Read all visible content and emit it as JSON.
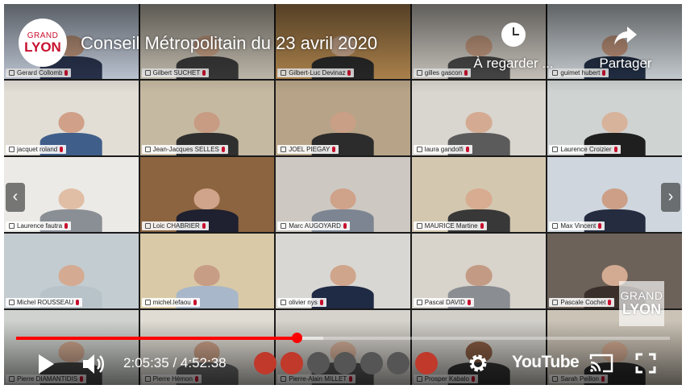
{
  "video": {
    "title": "Conseil Métropolitain du 23 avril 2020",
    "logo_line1": "GRAND",
    "logo_line2": "LYON",
    "watch_later_label": "À regarder ...",
    "share_label": "Partager",
    "watermark_line1": "GRAND",
    "watermark_line2": "LYON",
    "current_time": "2:05:35",
    "duration": "4:52:38",
    "time_display": "2:05:35 / 4:52:38",
    "progress_fraction": 0.4294,
    "buffered_fraction": 0.47,
    "youtube_label": "YouTube",
    "colors": {
      "accent": "#ff0000",
      "brand": "#c8102e"
    }
  },
  "participants": [
    {
      "name": "Gerard Collomb",
      "wall": "#c9d3e2",
      "skin": "#c49a80",
      "shirt": "#2b3550"
    },
    {
      "name": "Gilbert SUCHET",
      "wall": "#cdc6b8",
      "skin": "#d3a98c",
      "shirt": "#3b3b3b"
    },
    {
      "name": "Gilbert-Luc Devinaz",
      "wall": "#b98c52",
      "skin": "#d8b498",
      "shirt": "#2a2a2a"
    },
    {
      "name": "gilles gascon",
      "wall": "#d5d0c8",
      "skin": "#cfa488",
      "shirt": "#4a4a4a"
    },
    {
      "name": "guimet hubert",
      "wall": "#d4dbe0",
      "skin": "#c99b82",
      "shirt": "#233046"
    },
    {
      "name": "jacquet roland",
      "wall": "#e2ded6",
      "skin": "#d0a088",
      "shirt": "#3f5f8a"
    },
    {
      "name": "Jean-Jacques SELLES",
      "wall": "#c6b9a2",
      "skin": "#c89c83",
      "shirt": "#2f2f2f"
    },
    {
      "name": "JOEL PIEGAY",
      "wall": "#b7a488",
      "skin": "#c99f86",
      "shirt": "#2c2c2c"
    },
    {
      "name": "laura gandolfi",
      "wall": "#d9d5cf",
      "skin": "#d4ab92",
      "shirt": "#5b5b5b"
    },
    {
      "name": "Laurence Croizier",
      "wall": "#cfd3d2",
      "skin": "#d8b39b",
      "shirt": "#1f1f1f"
    },
    {
      "name": "Laurence fautra",
      "wall": "#eceae6",
      "skin": "#e0bea6",
      "shirt": "#8a8f96"
    },
    {
      "name": "Loic CHABRIER",
      "wall": "#8c6440",
      "skin": "#d0a48a",
      "shirt": "#1f2030"
    },
    {
      "name": "Marc AUGOYARD",
      "wall": "#cdc9c2",
      "skin": "#cfa28a",
      "shirt": "#7d8592"
    },
    {
      "name": "MAURICE Martine",
      "wall": "#d3c7b0",
      "skin": "#d7ac90",
      "shirt": "#383838"
    },
    {
      "name": "Max Vincent",
      "wall": "#cfd6de",
      "skin": "#cc9f86",
      "shirt": "#252c40"
    },
    {
      "name": "Michel ROUSSEAU",
      "wall": "#c3ccd0",
      "skin": "#d4ab92",
      "shirt": "#b7c3c9"
    },
    {
      "name": "michel.lefaou",
      "wall": "#d9c9a6",
      "skin": "#c89d85",
      "shirt": "#a8b7c9"
    },
    {
      "name": "olivier nys",
      "wall": "#d9d7d3",
      "skin": "#cfa58c",
      "shirt": "#1f2a44"
    },
    {
      "name": "Pascal DAVID",
      "wall": "#d8d3cb",
      "skin": "#c39b84",
      "shirt": "#8a8d92"
    },
    {
      "name": "Pascale Cochet",
      "wall": "#6d625a",
      "skin": "#d3ab92",
      "shirt": "#3a2f2a"
    },
    {
      "name": "Pierre DIAMANTIDIS",
      "wall": "#cfd2ce",
      "skin": "#d0a890",
      "shirt": "#444"
    },
    {
      "name": "Pierre Hémon",
      "wall": "#e0dcd4",
      "skin": "#cfa48b",
      "shirt": "#666"
    },
    {
      "name": "Pierre-Alain MILLET",
      "wall": "#d6d2cc",
      "skin": "#d6b09a",
      "shirt": "#555"
    },
    {
      "name": "Prosper Kabalo",
      "wall": "#d2cfc9",
      "skin": "#8a5e44",
      "shirt": "#333"
    },
    {
      "name": "Sarah Peillon",
      "wall": "#cbc3b6",
      "skin": "#d6ad94",
      "shirt": "#2a2a2a"
    }
  ]
}
